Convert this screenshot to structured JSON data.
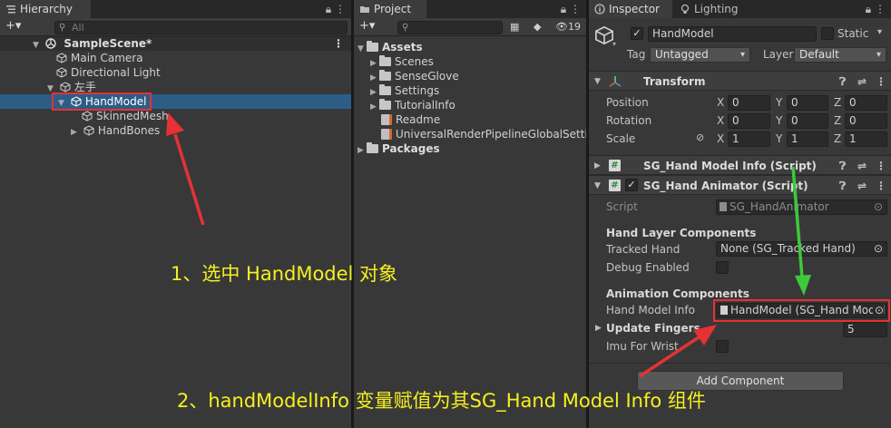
{
  "hierarchy": {
    "tab_label": "Hierarchy",
    "add_label": "+▾",
    "search_placeholder": "All",
    "scene_name": "SampleScene*",
    "items": [
      {
        "label": "Main Camera"
      },
      {
        "label": "Directional Light"
      },
      {
        "label": "左手"
      },
      {
        "label": "HandModel"
      },
      {
        "label": "SkinnedMesh"
      },
      {
        "label": "HandBones"
      }
    ]
  },
  "project": {
    "tab_label": "Project",
    "add_label": "+▾",
    "hidden_count": "19",
    "assets_label": "Assets",
    "folders": [
      {
        "label": "Scenes"
      },
      {
        "label": "SenseGlove"
      },
      {
        "label": "Settings"
      },
      {
        "label": "TutorialInfo"
      }
    ],
    "files": [
      {
        "label": "Readme"
      },
      {
        "label": "UniversalRenderPipelineGlobalSettings"
      }
    ],
    "packages_label": "Packages"
  },
  "inspector": {
    "tab_inspector": "Inspector",
    "tab_lighting": "Lighting",
    "object_name": "HandModel",
    "static_label": "Static",
    "tag_label": "Tag",
    "tag_value": "Untagged",
    "layer_label": "Layer",
    "layer_value": "Default",
    "transform": {
      "title": "Transform",
      "position_label": "Position",
      "rotation_label": "Rotation",
      "scale_label": "Scale",
      "position": {
        "x": "0",
        "y": "0",
        "z": "0"
      },
      "rotation": {
        "x": "0",
        "y": "0",
        "z": "0"
      },
      "scale": {
        "x": "1",
        "y": "1",
        "z": "1"
      },
      "x_label": "X",
      "y_label": "Y",
      "z_label": "Z"
    },
    "model_info_component": {
      "title": "SG_Hand Model Info (Script)"
    },
    "animator_component": {
      "title": "SG_Hand Animator (Script)",
      "script_label": "Script",
      "script_value": "SG_HandAnimator",
      "section_hand_layer": "Hand Layer Components",
      "tracked_hand_label": "Tracked Hand",
      "tracked_hand_value": "None (SG_Tracked Hand)",
      "debug_enabled_label": "Debug Enabled",
      "section_animation": "Animation Components",
      "hand_model_info_label": "Hand Model Info",
      "hand_model_info_value": "HandModel (SG_Hand Model Info)",
      "update_fingers_label": "Update Fingers",
      "update_fingers_value": "5",
      "imu_for_wrist_label": "Imu For Wrist"
    },
    "add_component_label": "Add Component"
  },
  "annotations": {
    "step1": "1、选中 HandModel 对象",
    "step2": "2、handModelInfo 变量赋值为其SG_Hand Model Info 组件"
  },
  "colors": {
    "annotation_text": "#f5f020",
    "red_marker": "#e53235",
    "green_marker": "#3ec93a",
    "selection": "#2c5d87"
  }
}
